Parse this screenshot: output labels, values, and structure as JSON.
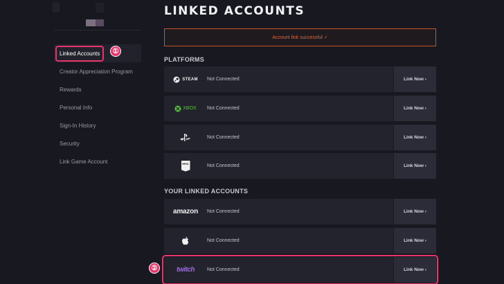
{
  "sidebar": {
    "items": [
      {
        "label": "Linked Accounts"
      },
      {
        "label": "Creator Appreciation Program"
      },
      {
        "label": "Rewards"
      },
      {
        "label": "Personal Info"
      },
      {
        "label": "Sign-In History"
      },
      {
        "label": "Security"
      },
      {
        "label": "Link Game Account"
      }
    ]
  },
  "annotations": {
    "marker1": "①",
    "marker2": "②"
  },
  "main": {
    "title": "LINKED ACCOUNTS",
    "alert": "Account link successful ✓",
    "platforms_heading": "PLATFORMS",
    "linked_heading": "YOUR LINKED ACCOUNTS",
    "platforms": [
      {
        "logo_text": "STEAM",
        "status": "Not Connected",
        "action": "Link Now ›"
      },
      {
        "logo_text": "XBOX",
        "status": "Not Connected",
        "action": "Link Now ›"
      },
      {
        "logo_text": "",
        "status": "Not Connected",
        "action": "Link Now ›"
      },
      {
        "logo_text": "EPIC",
        "status": "Not Connected",
        "action": "Link Now ›"
      }
    ],
    "accounts": [
      {
        "logo_text": "amazon",
        "status": "Not Connected",
        "action": "Link Now ›"
      },
      {
        "logo_text": "",
        "status": "Not Connected",
        "action": "Link Now ›"
      },
      {
        "logo_text": "twitch",
        "status": "Not Connected",
        "action": "Link Now ›"
      }
    ]
  },
  "colors": {
    "background": "#181821",
    "row": "#23232e",
    "accent": "#e8336b",
    "alert": "#e06a3e",
    "twitch": "#9b6bd6",
    "xbox": "#55c23a"
  }
}
